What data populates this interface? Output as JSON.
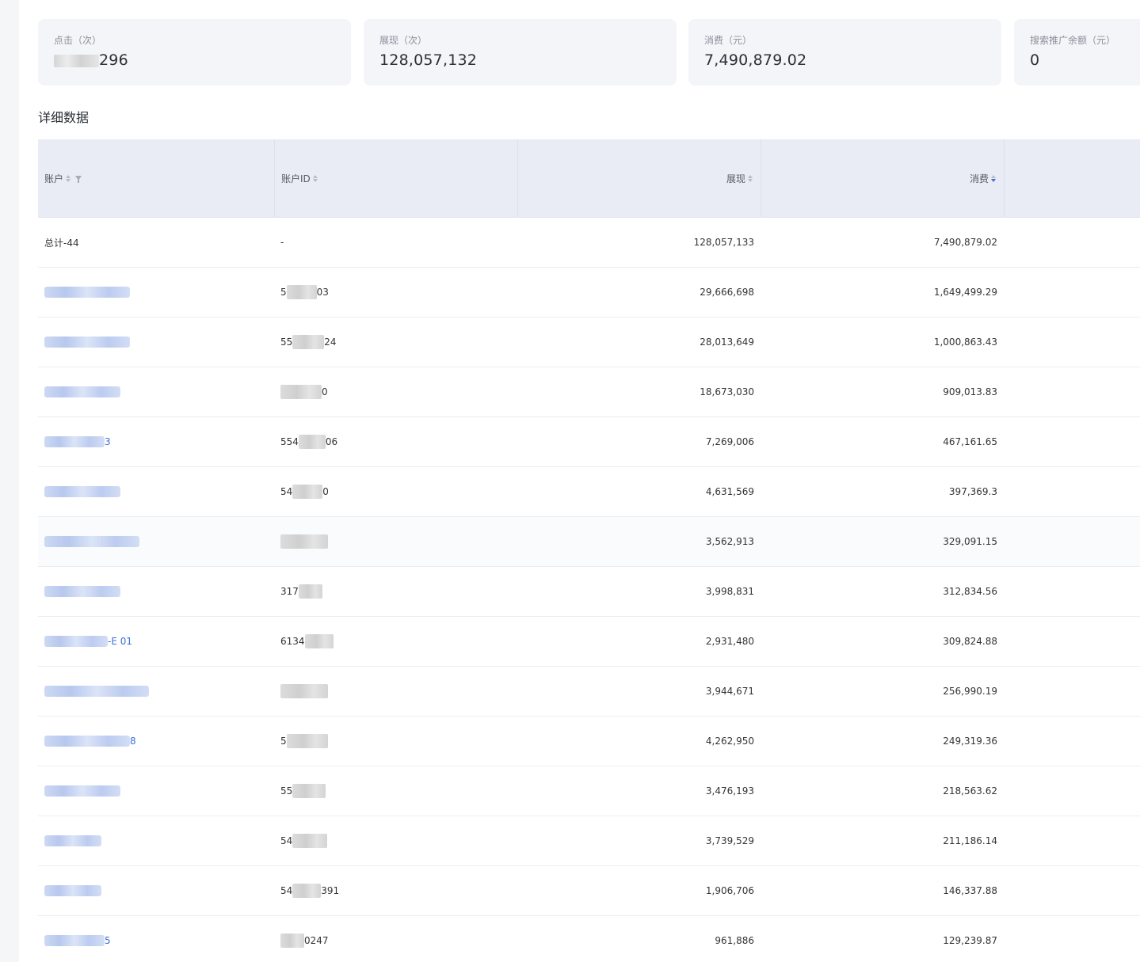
{
  "cards": [
    {
      "label": "点击（次）",
      "value": "296",
      "masked_prefix": true
    },
    {
      "label": "展现（次）",
      "value": "128,057,132",
      "masked_prefix": false
    },
    {
      "label": "消费（元）",
      "value": "7,490,879.02",
      "masked_prefix": false
    },
    {
      "label": "搜索推广余额（元）",
      "value": "0",
      "masked_prefix": false
    }
  ],
  "section_title": "详细数据",
  "table": {
    "headers": {
      "account": "账户",
      "account_id": "账户ID",
      "impressions": "展现",
      "spend": "消费"
    },
    "total_row": {
      "account": "总计-44",
      "account_id": "-",
      "impressions": "128,057,133",
      "spend": "7,490,879.02"
    },
    "rows": [
      {
        "account_suffix": "",
        "id_prefix": "5",
        "id_suffix": "03",
        "impressions": "29,666,698",
        "spend": "1,649,499.29"
      },
      {
        "account_suffix": "",
        "id_prefix": "55",
        "id_suffix": "24",
        "impressions": "28,013,649",
        "spend": "1,000,863.43"
      },
      {
        "account_suffix": "",
        "id_prefix": "",
        "id_suffix": "0",
        "impressions": "18,673,030",
        "spend": "909,013.83"
      },
      {
        "account_suffix": "3",
        "id_prefix": "554",
        "id_suffix": "06",
        "impressions": "7,269,006",
        "spend": "467,161.65"
      },
      {
        "account_suffix": "",
        "id_prefix": "54",
        "id_suffix": "0",
        "impressions": "4,631,569",
        "spend": "397,369.3"
      },
      {
        "account_suffix": "",
        "id_prefix": "",
        "id_suffix": "",
        "impressions": "3,562,913",
        "spend": "329,091.15"
      },
      {
        "account_suffix": "",
        "id_prefix": "317",
        "id_suffix": "",
        "impressions": "3,998,831",
        "spend": "312,834.56"
      },
      {
        "account_suffix": "-E  01",
        "id_prefix": "6134",
        "id_suffix": "",
        "impressions": "2,931,480",
        "spend": "309,824.88"
      },
      {
        "account_suffix": "",
        "id_prefix": "",
        "id_suffix": "",
        "impressions": "3,944,671",
        "spend": "256,990.19"
      },
      {
        "account_suffix": "8",
        "id_prefix": "5",
        "id_suffix": "",
        "impressions": "4,262,950",
        "spend": "249,319.36"
      },
      {
        "account_suffix": "",
        "id_prefix": "55",
        "id_suffix": "",
        "impressions": "3,476,193",
        "spend": "218,563.62"
      },
      {
        "account_suffix": "",
        "id_prefix": "54",
        "id_suffix": "",
        "impressions": "3,739,529",
        "spend": "211,186.14"
      },
      {
        "account_suffix": "",
        "id_prefix": "54",
        "id_suffix": "391",
        "impressions": "1,906,706",
        "spend": "146,337.88"
      },
      {
        "account_suffix": "5",
        "id_prefix": "",
        "id_suffix": "0247",
        "impressions": "961,886",
        "spend": "129,239.87"
      }
    ]
  },
  "colors": {
    "link": "#3d6fd6",
    "sort_active": "#3d6fd6",
    "card_bg": "#f4f5f9",
    "header_bg": "#e9ecf4"
  }
}
